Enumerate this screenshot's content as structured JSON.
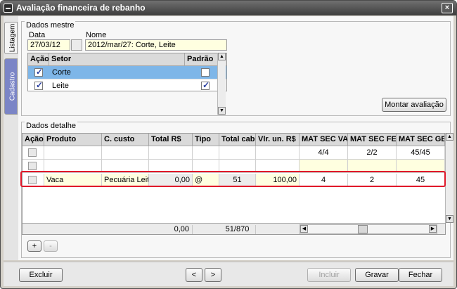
{
  "window": {
    "title": "Avaliação financeira de rebanho",
    "close_glyph": "×"
  },
  "sidetabs": {
    "listagem": "Listagem",
    "cadastro": "Cadastro"
  },
  "master": {
    "group_title": "Dados mestre",
    "data_label": "Data",
    "data_value": "27/03/12",
    "nome_label": "Nome",
    "nome_value": "2012/mar/27: Corte, Leite",
    "setor_table": {
      "headers": [
        "Ação",
        "Setor",
        "Padrão"
      ],
      "rows": [
        {
          "acao": true,
          "setor": "Corte",
          "padrao": false,
          "selected": true
        },
        {
          "acao": true,
          "setor": "Leite",
          "padrao": true,
          "selected": false
        }
      ]
    },
    "montar_button": "Montar avaliação"
  },
  "detail": {
    "group_title": "Dados detalhe",
    "headers": [
      "Ação",
      "Produto",
      "C. custo",
      "Total R$",
      "Tipo",
      "Total cab.",
      "Vlr. un. R$",
      "MAT SEC VAZ",
      "MAT SEC FEC",
      "MAT SEC GES"
    ],
    "row1": {
      "mat_sec_vaz": "4/4",
      "mat_sec_fec": "2/2",
      "mat_sec_ges": "45/45"
    },
    "data_row": {
      "produto": "Vaca",
      "c_custo": "Pecuária Leiteira",
      "total_rs": "0,00",
      "tipo": "@",
      "total_cab": "51",
      "vlr_un": "100,00",
      "mat_sec_vaz": "4",
      "mat_sec_fec": "2",
      "mat_sec_ges": "45"
    },
    "footer": {
      "total_rs": "0,00",
      "total_cab": "51/870"
    },
    "add_button": "+",
    "remove_button": "-"
  },
  "bottom": {
    "excluir": "Excluir",
    "prev": "<",
    "next": ">",
    "incluir": "Incluir",
    "gravar": "Gravar",
    "fechar": "Fechar"
  },
  "colors": {
    "highlight": "#e0182a",
    "selected_row": "#7eb6e8",
    "yellow_field": "#ffffe0",
    "active_tab": "#7b85c6"
  }
}
